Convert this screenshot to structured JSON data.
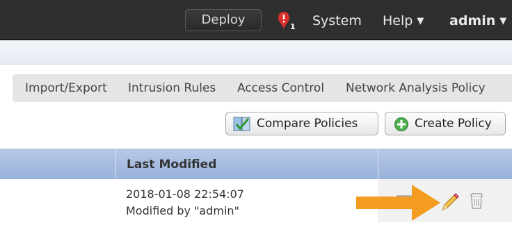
{
  "header": {
    "deploy_label": "Deploy",
    "alert_count": "1",
    "system_label": "System",
    "help_label": "Help",
    "user_label": "admin",
    "caret": "▼"
  },
  "subnav": {
    "items": [
      "Import/Export",
      "Intrusion Rules",
      "Access Control",
      "Network Analysis Policy"
    ]
  },
  "toolbar": {
    "compare_label": "Compare Policies",
    "create_label": "Create Policy"
  },
  "table": {
    "columns": [
      "Last Modified"
    ],
    "rows": [
      {
        "last_modified": "2018-01-08 22:54:07",
        "modified_by": "Modified by \"admin\""
      }
    ]
  },
  "colors": {
    "header_bg": "#2f2f2f",
    "table_header_bg": "#a7bde0",
    "annotation_arrow": "#f39c1f",
    "alert_red": "#d9302c"
  }
}
